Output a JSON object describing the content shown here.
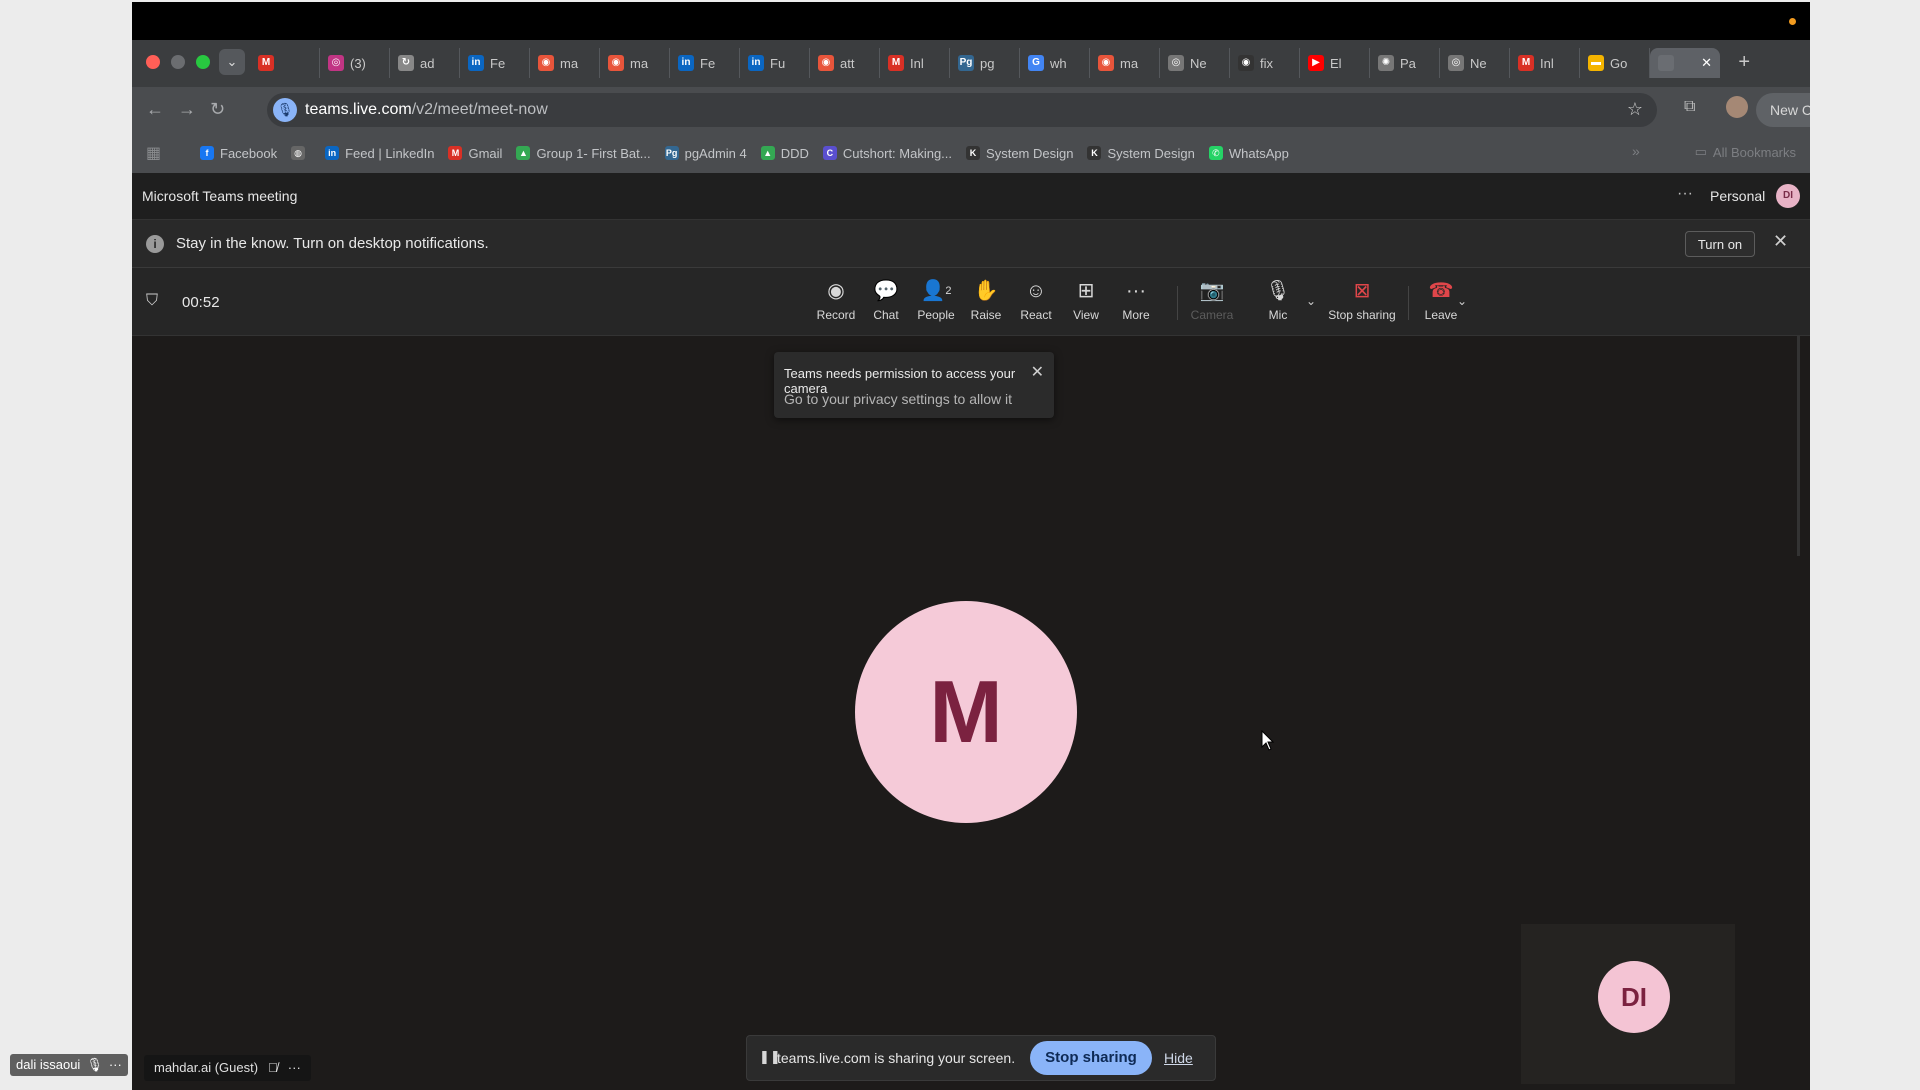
{
  "browser": {
    "tabs": [
      {
        "label": "",
        "icon": "gmail-icon",
        "color": "#d93025",
        "glyph": "M"
      },
      {
        "label": "(3)",
        "icon": "instagram-icon",
        "color": "#c13584",
        "glyph": "◎"
      },
      {
        "label": "ad",
        "icon": "loading-icon",
        "color": "#888888",
        "glyph": "↻"
      },
      {
        "label": "Fe",
        "icon": "linkedin-icon",
        "color": "#0a66c2",
        "glyph": "in"
      },
      {
        "label": "ma",
        "icon": "app-icon",
        "color": "#e8553b",
        "glyph": "◉"
      },
      {
        "label": "ma",
        "icon": "app-icon",
        "color": "#e8553b",
        "glyph": "◉"
      },
      {
        "label": "Fe",
        "icon": "linkedin-icon",
        "color": "#0a66c2",
        "glyph": "in"
      },
      {
        "label": "Fu",
        "icon": "linkedin-icon",
        "color": "#0a66c2",
        "glyph": "in"
      },
      {
        "label": "att",
        "icon": "app-icon",
        "color": "#e8553b",
        "glyph": "◉"
      },
      {
        "label": "Inl",
        "icon": "gmail-icon",
        "color": "#d93025",
        "glyph": "M"
      },
      {
        "label": "pg",
        "icon": "pgadmin-icon",
        "color": "#336791",
        "glyph": "Pg"
      },
      {
        "label": "wh",
        "icon": "google-icon",
        "color": "#4285f4",
        "glyph": "G"
      },
      {
        "label": "ma",
        "icon": "app-icon",
        "color": "#e8553b",
        "glyph": "◉"
      },
      {
        "label": "Ne",
        "icon": "chrome-icon",
        "color": "#777777",
        "glyph": "◎"
      },
      {
        "label": "fix",
        "icon": "github-icon",
        "color": "#333333",
        "glyph": "◉"
      },
      {
        "label": "El",
        "icon": "youtube-icon",
        "color": "#ff0000",
        "glyph": "▶"
      },
      {
        "label": "Pa",
        "icon": "chatgpt-icon",
        "color": "#777777",
        "glyph": "✺"
      },
      {
        "label": "Ne",
        "icon": "chrome-icon",
        "color": "#777777",
        "glyph": "◎"
      },
      {
        "label": "Inl",
        "icon": "gmail-icon",
        "color": "#d93025",
        "glyph": "M"
      },
      {
        "label": "Go",
        "icon": "slides-icon",
        "color": "#f4b400",
        "glyph": "▬"
      }
    ],
    "active_tab": {
      "label": "",
      "close": "✕"
    },
    "new_tab": "+",
    "url_host": "teams.live.com",
    "url_path": "/v2/meet/meet-now",
    "update_label": "New Chrome available",
    "bookmarks": [
      {
        "label": "Facebook",
        "icon": "facebook-icon",
        "color": "#1877f2",
        "glyph": "f"
      },
      {
        "label": "",
        "icon": "globe-icon",
        "color": "#666666",
        "glyph": "◍"
      },
      {
        "label": "Feed | LinkedIn",
        "icon": "linkedin-icon",
        "color": "#0a66c2",
        "glyph": "in"
      },
      {
        "label": "Gmail",
        "icon": "gmail-icon",
        "color": "#d93025",
        "glyph": "M"
      },
      {
        "label": "Group 1- First Bat...",
        "icon": "drive-icon",
        "color": "#34a853",
        "glyph": "▲"
      },
      {
        "label": "pgAdmin 4",
        "icon": "pgadmin-icon",
        "color": "#336791",
        "glyph": "Pg"
      },
      {
        "label": "DDD",
        "icon": "drive-icon",
        "color": "#34a853",
        "glyph": "▲"
      },
      {
        "label": "Cutshort: Making...",
        "icon": "cutshort-icon",
        "color": "#5a4fcf",
        "glyph": "C"
      },
      {
        "label": "System Design",
        "icon": "k-icon",
        "color": "#333333",
        "glyph": "K"
      },
      {
        "label": "System Design",
        "icon": "k-icon",
        "color": "#333333",
        "glyph": "K"
      },
      {
        "label": "WhatsApp",
        "icon": "whatsapp-icon",
        "color": "#25d366",
        "glyph": "✆"
      }
    ],
    "all_bookmarks": "All Bookmarks"
  },
  "teams": {
    "title": "Microsoft Teams meeting",
    "account_label": "Personal",
    "account_initials": "DI",
    "notification": {
      "text": "Stay in the know. Turn on desktop notifications.",
      "button": "Turn on"
    },
    "timer": "00:52",
    "controls": {
      "record": "Record",
      "chat": "Chat",
      "people": "People",
      "people_count": "2",
      "raise": "Raise",
      "react": "React",
      "view": "View",
      "more": "More",
      "camera": "Camera",
      "mic": "Mic",
      "stop_sharing": "Stop sharing",
      "leave": "Leave"
    },
    "toast": {
      "title": "Teams needs permission to access your camera",
      "body": "Go to your privacy settings to allow it"
    },
    "participant_initial": "M",
    "self_initials": "DI",
    "name_tag": "mahdar.ai (Guest)",
    "share_banner": {
      "text": "teams.live.com is sharing your screen.",
      "stop": "Stop sharing",
      "hide": "Hide"
    }
  },
  "overlay": {
    "host_name": "dali issaoui"
  },
  "colors": {
    "accent_blue": "#8ab4f8",
    "leave_red": "#e0464a",
    "avatar_pink": "#f5cad8"
  }
}
